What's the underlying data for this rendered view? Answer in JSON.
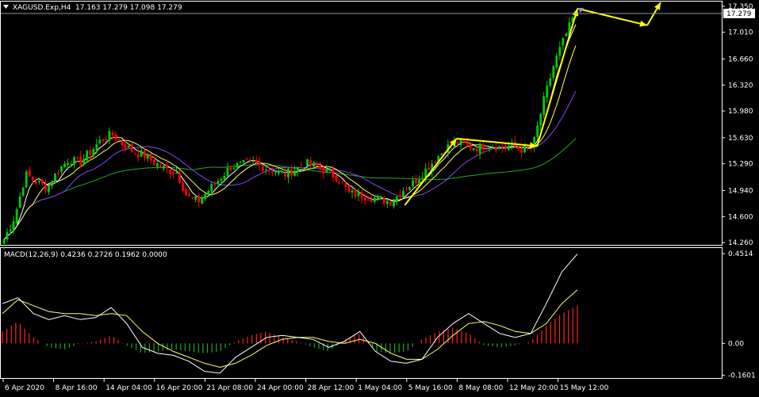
{
  "colors": {
    "background": "#000000",
    "frame": "#ffffff",
    "axis_text": "#ffffff",
    "bull_candle": "#00cc00",
    "bear_candle": "#ff0000",
    "ma_fast": "#ffffff",
    "ma_mid": "#ffff66",
    "ma_slow": "#8844ff",
    "ma_long": "#22aa22",
    "annotation": "#ffff00",
    "macd_line": "#ffffff",
    "signal_line": "#ffff66",
    "hist_positive": "#ff2222",
    "hist_negative": "#22aa22",
    "price_box_bg": "#ffffff",
    "price_box_text": "#000000"
  },
  "header": {
    "menu_icon": "triangle-down-icon",
    "symbol_info": "XAGUSD.Exp,H4  17.163 17.279 17.098 17.279"
  },
  "macd_header": "MACD(12,26,9) 0.4236 0.2726 0.1962 0.0000",
  "current_price_label": "17.279",
  "price_axis": {
    "ticks": [
      "17.350",
      "17.010",
      "16.660",
      "16.320",
      "15.980",
      "15.630",
      "15.290",
      "14.940",
      "14.600",
      "14.260"
    ],
    "values": [
      17.35,
      17.01,
      16.66,
      16.32,
      15.98,
      15.63,
      15.29,
      14.94,
      14.6,
      14.26
    ]
  },
  "macd_axis": {
    "ticks": [
      "0.4514",
      "0.00",
      "-0.1601"
    ],
    "values": [
      0.4514,
      0.0,
      -0.1601
    ]
  },
  "time_axis": {
    "labels": [
      "6 Apr 2020",
      "8 Apr 16:00",
      "14 Apr 04:00",
      "16 Apr 20:00",
      "21 Apr 08:00",
      "24 Apr 00:00",
      "28 Apr 12:00",
      "1 May 04:00",
      "5 May 16:00",
      "8 May 08:00",
      "12 May 20:00",
      "15 May 12:00"
    ]
  },
  "chart_data": {
    "type": "candlestick",
    "symbol": "XAGUSD.Exp",
    "timeframe": "H4",
    "price_range": [
      14.23,
      17.4
    ],
    "macd_range": [
      -0.17,
      0.46
    ],
    "close_series": [
      14.3,
      14.6,
      15.15,
      15.05,
      14.98,
      15.2,
      15.35,
      15.3,
      15.45,
      15.6,
      15.68,
      15.55,
      15.45,
      15.4,
      15.3,
      15.22,
      15.18,
      14.85,
      14.8,
      14.95,
      15.1,
      15.25,
      15.28,
      15.3,
      15.25,
      15.2,
      15.15,
      15.22,
      15.3,
      15.25,
      15.18,
      15.1,
      14.9,
      14.88,
      14.85,
      14.82,
      14.8,
      14.95,
      15.05,
      15.2,
      15.35,
      15.5,
      15.58,
      15.52,
      15.5,
      15.55,
      15.5,
      15.52,
      15.48,
      15.5,
      16.1,
      16.6,
      16.95,
      17.28
    ],
    "macd_main": [
      0.2,
      0.23,
      0.15,
      0.12,
      0.14,
      0.12,
      0.13,
      0.18,
      0.1,
      -0.02,
      -0.05,
      -0.06,
      -0.09,
      -0.14,
      -0.15,
      -0.07,
      -0.02,
      0.03,
      0.04,
      0.03,
      0.02,
      -0.02,
      0.01,
      0.06,
      -0.04,
      -0.09,
      -0.1,
      -0.08,
      0.03,
      0.1,
      0.15,
      0.1,
      0.05,
      0.03,
      0.05,
      0.2,
      0.36,
      0.45
    ],
    "macd_signal": [
      0.15,
      0.22,
      0.19,
      0.16,
      0.15,
      0.15,
      0.14,
      0.15,
      0.14,
      0.06,
      0.0,
      -0.04,
      -0.07,
      -0.1,
      -0.12,
      -0.1,
      -0.06,
      -0.01,
      0.02,
      0.03,
      0.03,
      0.01,
      0.0,
      0.02,
      0.0,
      -0.05,
      -0.08,
      -0.08,
      -0.03,
      0.04,
      0.1,
      0.11,
      0.09,
      0.06,
      0.05,
      0.1,
      0.2,
      0.27
    ],
    "macd_histogram": [
      0.06,
      0.11,
      0.03,
      -0.02,
      -0.03,
      0.0,
      0.01,
      0.04,
      -0.01,
      -0.05,
      -0.04,
      -0.03,
      -0.04,
      -0.05,
      -0.04,
      0.01,
      0.04,
      0.06,
      0.03,
      0.01,
      -0.02,
      -0.04,
      0.02,
      0.05,
      -0.04,
      -0.05,
      -0.04,
      0.02,
      0.06,
      0.08,
      0.05,
      -0.01,
      -0.02,
      -0.01,
      0.01,
      0.09,
      0.15,
      0.19
    ]
  }
}
